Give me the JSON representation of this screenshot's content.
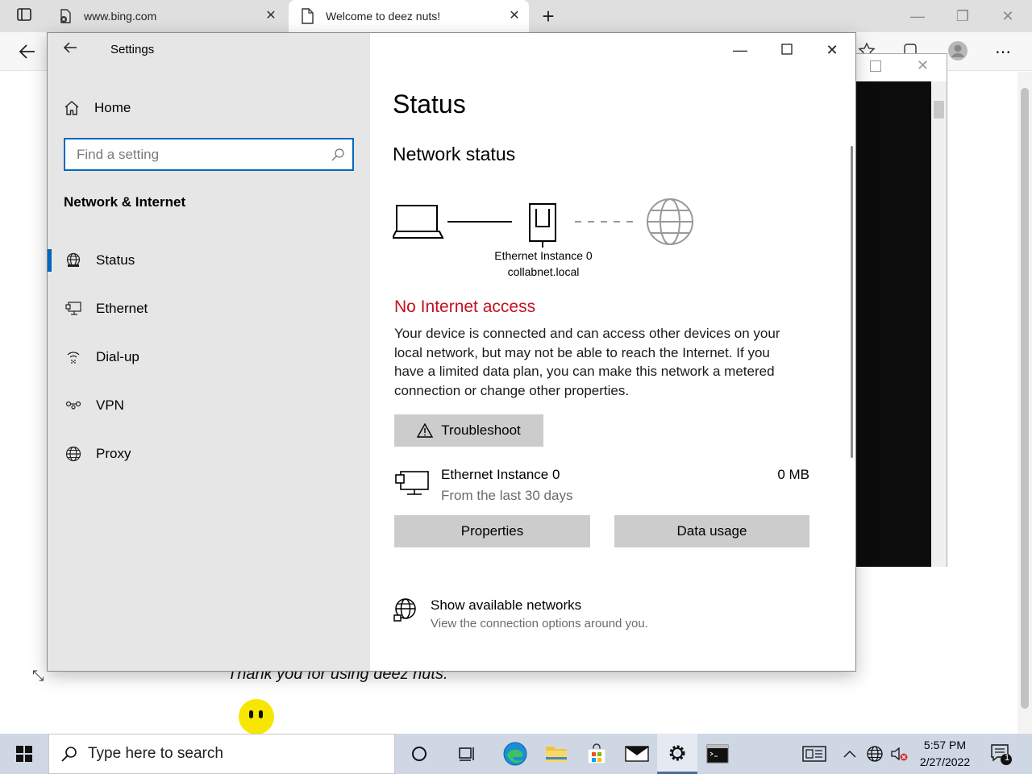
{
  "browser": {
    "tabs": [
      {
        "title": "www.bing.com"
      },
      {
        "title": "Welcome to deez nuts!"
      }
    ],
    "close_glyph": "✕",
    "new_tab_glyph": "+"
  },
  "webpage": {
    "thanks_text": "Thank you for using deez nuts."
  },
  "settings": {
    "window_title": "Settings",
    "home_label": "Home",
    "search_placeholder": "Find a setting",
    "section_title": "Network & Internet",
    "nav": [
      {
        "label": "Status",
        "icon": "status-globe-icon",
        "active": true
      },
      {
        "label": "Ethernet",
        "icon": "ethernet-icon",
        "active": false
      },
      {
        "label": "Dial-up",
        "icon": "dialup-icon",
        "active": false
      },
      {
        "label": "VPN",
        "icon": "vpn-icon",
        "active": false
      },
      {
        "label": "Proxy",
        "icon": "globe-icon",
        "active": false
      }
    ],
    "page_title": "Status",
    "section_heading": "Network status",
    "adapter": {
      "name": "Ethernet Instance 0",
      "domain": "collabnet.local"
    },
    "alert_title": "No Internet access",
    "alert_description": "Your device is connected and can access other devices on your local network, but may not be able to reach the Internet. If you have a limited data plan, you can make this network a metered connection or change other properties.",
    "troubleshoot_label": "Troubleshoot",
    "usage": {
      "adapter_name": "Ethernet Instance 0",
      "period": "From the last 30 days",
      "amount": "0 MB"
    },
    "properties_label": "Properties",
    "data_usage_label": "Data usage",
    "show_networks": {
      "title": "Show available networks",
      "subtitle": "View the connection options around you."
    }
  },
  "taskbar": {
    "search_placeholder": "Type here to search",
    "time": "5:57 PM",
    "date": "2/27/2022",
    "notification_count": "1"
  },
  "colors": {
    "accent": "#0067c0",
    "alert": "#c50f1f",
    "sidebar_bg": "#e6e6e6",
    "button_bg": "#cccccc"
  }
}
